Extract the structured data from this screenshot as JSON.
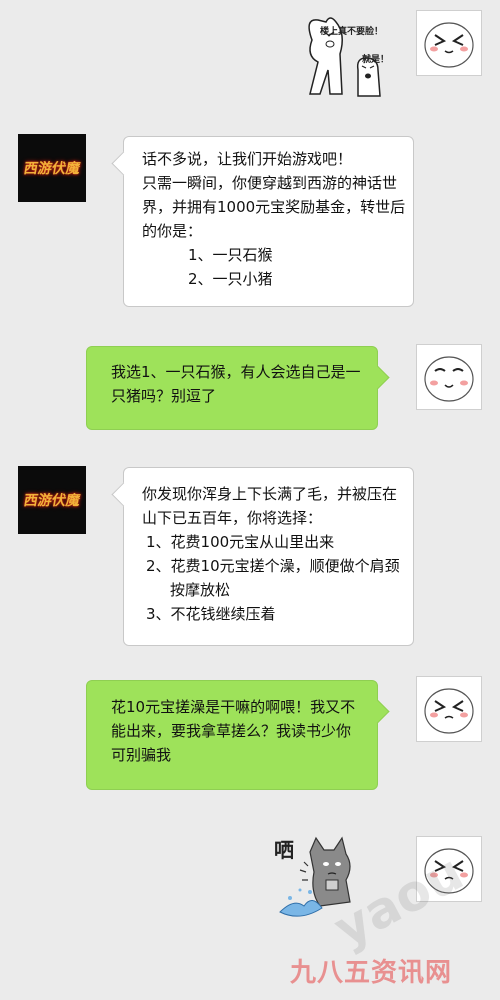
{
  "messages": [
    {
      "side": "right",
      "type": "sticker",
      "captions": [
        "楼上真不要脸！",
        "就是！"
      ]
    },
    {
      "side": "left",
      "sender_logo": "西游伏魔",
      "lines": [
        "话不多说，让我们开始游戏吧！",
        "只需一瞬间，你便穿越到西游的神话世",
        "界，并拥有1000元宝奖励基金，转世后",
        "的你是：",
        "1、一只石猴",
        "2、一只小猪"
      ]
    },
    {
      "side": "right",
      "lines": [
        "我选1、一只石猴，有人会选自己是一",
        "只猪吗？别逗了"
      ]
    },
    {
      "side": "left",
      "sender_logo": "西游伏魔",
      "lines": [
        "你发现你浑身上下长满了毛，并被压在",
        "山下已五百年，你将选择：",
        "1、花费100元宝从山里出来",
        "2、花费10元宝搓个澡，顺便做个肩颈",
        "按摩放松",
        "3、不花钱继续压着"
      ]
    },
    {
      "side": "right",
      "lines": [
        "花10元宝搓澡是干嘛的啊喂！我又不",
        "能出来，要我拿草搓么？我读书少你",
        "可别骗我"
      ]
    },
    {
      "side": "right",
      "type": "sticker",
      "captions": [
        "哂"
      ]
    }
  ],
  "watermark": {
    "site_logo": "yaou",
    "site_name": "九八五资讯网"
  }
}
